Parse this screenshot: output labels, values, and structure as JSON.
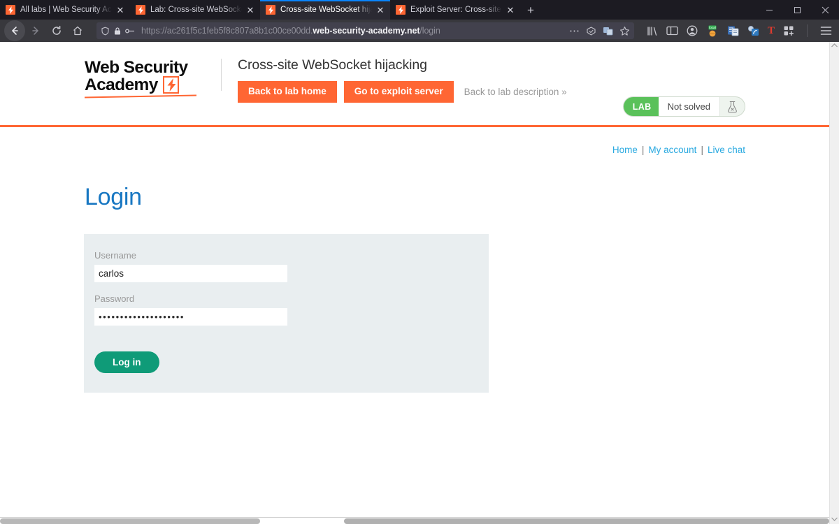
{
  "browser": {
    "tabs": [
      {
        "title": "All labs | Web Security Academy",
        "favicon": "portswigger-bolt-icon",
        "active": false,
        "close_label": "✕"
      },
      {
        "title": "Lab: Cross-site WebSocket hijac",
        "favicon": "portswigger-bolt-icon",
        "active": false,
        "close_label": "✕"
      },
      {
        "title": "Cross-site WebSocket hijacking",
        "favicon": "portswigger-bolt-icon",
        "active": true,
        "close_label": "✕"
      },
      {
        "title": "Exploit Server: Cross-site WebS",
        "favicon": "portswigger-bolt-icon",
        "active": false,
        "close_label": "✕"
      }
    ],
    "new_tab_label": "+",
    "window_controls": {
      "minimize": "—",
      "maximize": "❐",
      "close": "✕"
    },
    "nav": {
      "back_label": "←",
      "forward_label": "→",
      "reload_label": "⟳",
      "home_label": "⌂"
    },
    "url": {
      "prefix": "https://ac261f5c1feb5f8c807a8b1c00ce00dd.",
      "host": "web-security-academy.net",
      "path": "/login",
      "full": "https://ac261f5c1feb5f8c807a8b1c00ce00dd.web-security-academy.net/login",
      "shield_icon": "tracking-protection-shield-icon",
      "lock_icon": "padlock-icon",
      "permission_icon": "permissions-icon"
    },
    "url_actions": {
      "more": "⋯",
      "reader": "reader-mode-icon",
      "translate": "translate-icon",
      "bookmark": "star-icon"
    },
    "toolbar_icons": [
      "library-icon",
      "sidebar-icon",
      "account-icon",
      "burp-local-extension-icon",
      "cookie-editor-icon",
      "foxyproxy-icon",
      "tamper-icon",
      "extensions-grid-icon",
      "app-menu-icon"
    ]
  },
  "academy": {
    "logo": {
      "line1": "Web Security",
      "line2": "Academy",
      "mark": "portswigger-bolt-mark"
    },
    "lab_title": "Cross-site WebSocket hijacking",
    "buttons": {
      "back_to_lab_home": "Back to lab home",
      "go_to_exploit_server": "Go to exploit server",
      "back_to_lab_description": "Back to lab description »"
    },
    "lab_status": {
      "badge": "LAB",
      "text": "Not solved",
      "icon": "flask-icon",
      "badge_color": "#5ac15a"
    }
  },
  "site_nav": {
    "home": "Home",
    "my_account": "My account",
    "live_chat": "Live chat",
    "separator": "|"
  },
  "login": {
    "heading": "Login",
    "username": {
      "label": "Username",
      "value": "carlos"
    },
    "password": {
      "label": "Password",
      "value": "••••••••••••••••••••"
    },
    "submit_label": "Log in"
  },
  "colors": {
    "accent_orange": "#ff6633",
    "link_blue": "#29a9e0",
    "title_blue": "#1877c2",
    "button_green": "#0f9b78",
    "panel_bg": "#e9eef0"
  }
}
